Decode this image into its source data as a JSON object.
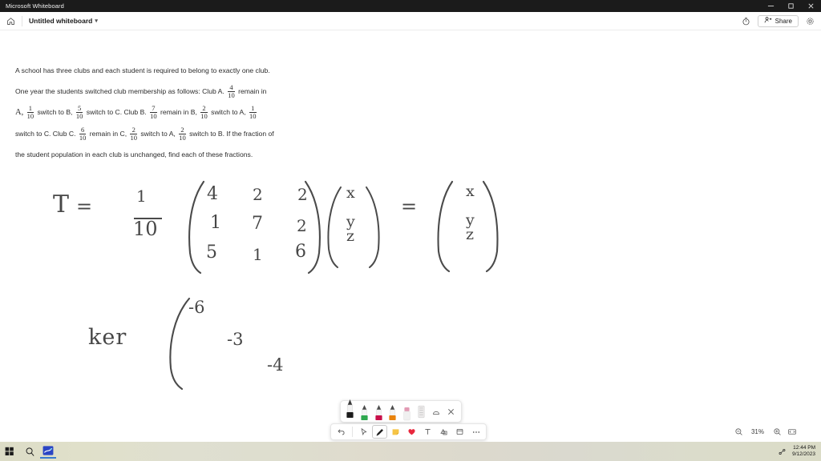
{
  "window": {
    "app_title": "Microsoft Whiteboard",
    "controls": {
      "minimize": "minimize-icon",
      "maximize": "maximize-icon",
      "close": "close-icon"
    }
  },
  "command_bar": {
    "home_icon": "home-icon",
    "document_title": "Untitled whiteboard",
    "title_chevron": "chevron-down-icon",
    "timer_icon": "timer-icon",
    "share_label": "Share",
    "share_icon": "share-person-icon",
    "settings_icon": "gear-icon"
  },
  "canvas": {
    "problem": {
      "line1": "A school has three clubs and each student is required to belong to exactly one club.",
      "line2_a": "One year the students switched club membership as follows: Club A.",
      "line2_frac": {
        "num": "4",
        "den": "10"
      },
      "line2_b": "remain in",
      "line3_a": "A,",
      "line3_f1": {
        "num": "1",
        "den": "10"
      },
      "line3_b": "switch to B,",
      "line3_f2": {
        "num": "5",
        "den": "10"
      },
      "line3_c": "switch to C. Club B.",
      "line3_f3": {
        "num": "7",
        "den": "10"
      },
      "line3_d": "remain in B,",
      "line3_f4": {
        "num": "2",
        "den": "10"
      },
      "line3_e": "switch to A,",
      "line3_f5": {
        "num": "1",
        "den": "10"
      },
      "line4_a": "switch to C. Club C.",
      "line4_f1": {
        "num": "6",
        "den": "10"
      },
      "line4_b": "remain in C,",
      "line4_f2": {
        "num": "2",
        "den": "10"
      },
      "line4_c": "switch to A,",
      "line4_f3": {
        "num": "2",
        "den": "10"
      },
      "line4_d": "switch to B. If the fraction of",
      "line5": "the student population in each club is unchanged, find each of these fractions."
    },
    "handwriting": {
      "eq_label": "T",
      "eq_equals": "=",
      "eq_scalar_num": "1",
      "eq_scalar_den": "10",
      "matrix_rows": [
        [
          "4",
          "2",
          "2"
        ],
        [
          "1",
          "7",
          "2"
        ],
        [
          "5",
          "1",
          "6"
        ]
      ],
      "vector_left": [
        "x",
        "y",
        "z"
      ],
      "eq2_equals": "=",
      "vector_right": [
        "x",
        "y",
        "z"
      ],
      "ker_label": "ker",
      "ker_diagonal": [
        "-6",
        "-3",
        "-4"
      ]
    }
  },
  "pen_palette": {
    "tools": [
      {
        "name": "pen-black",
        "color": "#1c1c1c",
        "selected": true
      },
      {
        "name": "pen-green",
        "color": "#2fa84f",
        "selected": false
      },
      {
        "name": "pen-red",
        "color": "#c8104a",
        "selected": false
      },
      {
        "name": "pen-orange",
        "color": "#e8820c",
        "selected": false
      },
      {
        "name": "highlighter-pink",
        "color": "#e29bb4",
        "selected": false
      },
      {
        "name": "eraser",
        "color": "#bdbdbd",
        "selected": false
      }
    ],
    "ruler_icon": "ruler-icon",
    "close_icon": "close-icon"
  },
  "main_toolbar": {
    "items": [
      {
        "name": "undo-button",
        "icon": "undo-icon",
        "active": false
      },
      {
        "name": "select-tool",
        "icon": "cursor-icon",
        "active": false
      },
      {
        "name": "pen-tool",
        "icon": "pen-icon",
        "active": true
      },
      {
        "name": "note-tool",
        "icon": "sticky-note-icon",
        "active": false
      },
      {
        "name": "reaction-tool",
        "icon": "heart-icon",
        "active": false
      },
      {
        "name": "text-tool",
        "icon": "text-icon",
        "active": false
      },
      {
        "name": "shapes-tool",
        "icon": "shapes-icon",
        "active": false
      },
      {
        "name": "image-tool",
        "icon": "image-icon",
        "active": false
      },
      {
        "name": "more-tools",
        "icon": "ellipsis-icon",
        "active": false
      }
    ]
  },
  "zoom_controls": {
    "zoom_out_icon": "zoom-out-icon",
    "zoom_level": "31%",
    "zoom_in_icon": "zoom-in-icon",
    "fit_icon": "fit-to-screen-icon"
  },
  "taskbar": {
    "start_icon": "windows-start-icon",
    "search_icon": "search-icon",
    "app_icon": "whiteboard-app-icon",
    "tray_icon": "network-icon",
    "time": "12:44 PM",
    "date": "9/12/2023"
  },
  "colors": {
    "titlebar_bg": "#1b1b1b",
    "canvas_bg": "#ffffff",
    "ink": "#474747",
    "accent": "#3a7bd0"
  }
}
